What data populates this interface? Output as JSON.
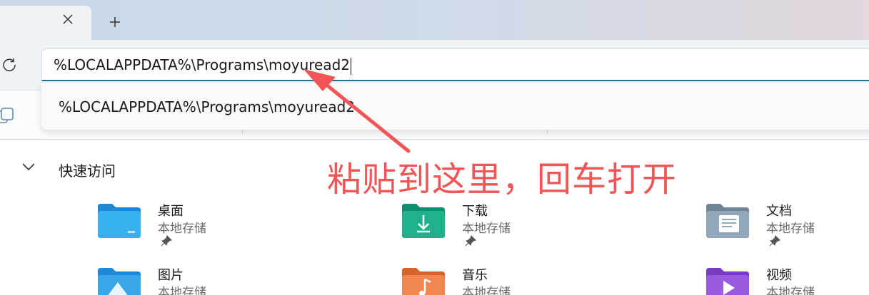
{
  "tab": {
    "close_icon": "close-icon",
    "new_tab_icon": "plus-icon"
  },
  "toolbar": {
    "refresh_icon": "refresh-icon"
  },
  "address_bar": {
    "value": "%LOCALAPPDATA%\\Programs\\moyuread2"
  },
  "suggestions": [
    {
      "label": "%LOCALAPPDATA%\\Programs\\moyuread2"
    }
  ],
  "annotation": {
    "text": "粘贴到这里，回车打开",
    "color": "#f25555"
  },
  "quick_access": {
    "title": "快速访问",
    "items": [
      {
        "name": "桌面",
        "location": "本地存储",
        "pinned": true,
        "icon": "desktop-folder-icon"
      },
      {
        "name": "下载",
        "location": "本地存储",
        "pinned": true,
        "icon": "downloads-folder-icon"
      },
      {
        "name": "文档",
        "location": "本地存储",
        "pinned": true,
        "icon": "documents-folder-icon"
      },
      {
        "name": "图片",
        "location": "本地存储",
        "pinned": false,
        "icon": "pictures-folder-icon"
      },
      {
        "name": "音乐",
        "location": "本地存储",
        "pinned": false,
        "icon": "music-folder-icon"
      },
      {
        "name": "视频",
        "location": "本地存储",
        "pinned": false,
        "icon": "videos-folder-icon"
      }
    ]
  },
  "colors": {
    "accent": "#2a6f8c",
    "annotation": "#f25555"
  }
}
